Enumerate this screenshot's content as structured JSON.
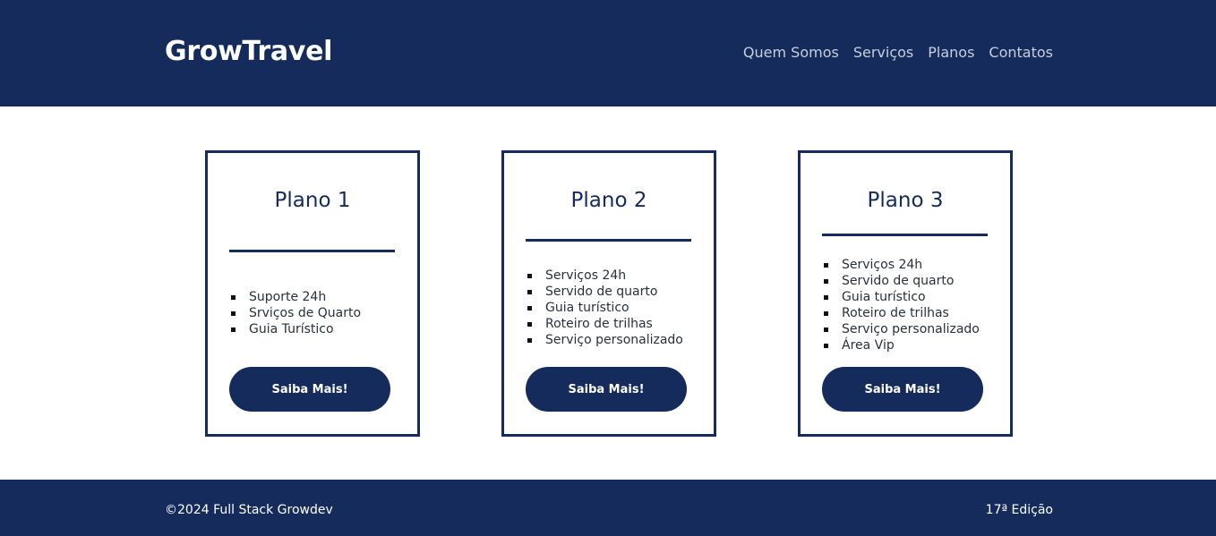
{
  "header": {
    "logo": "GrowTravel",
    "nav": [
      "Quem Somos",
      "Serviços",
      "Planos",
      "Contatos"
    ]
  },
  "plans": [
    {
      "title": "Plano 1",
      "features": [
        "Suporte 24h",
        "Srviços de Quarto",
        "Guia Turístico"
      ],
      "button": "Saiba Mais!"
    },
    {
      "title": "Plano 2",
      "features": [
        "Serviços 24h",
        "Servido de quarto",
        "Guia turístico",
        "Roteiro de trilhas",
        "Serviço personalizado"
      ],
      "button": "Saiba Mais!"
    },
    {
      "title": "Plano 3",
      "features": [
        "Serviços 24h",
        "Servido de quarto",
        "Guia turístico",
        "Roteiro de trilhas",
        "Serviço personalizado",
        "Área Vip"
      ],
      "button": "Saiba Mais!"
    }
  ],
  "footer": {
    "copyright": "©2024 Full Stack Growdev",
    "edition": "17ª Edição"
  },
  "colors": {
    "primary": "#142b5c",
    "nav_text": "#c7cfde",
    "background": "#ffffff"
  }
}
